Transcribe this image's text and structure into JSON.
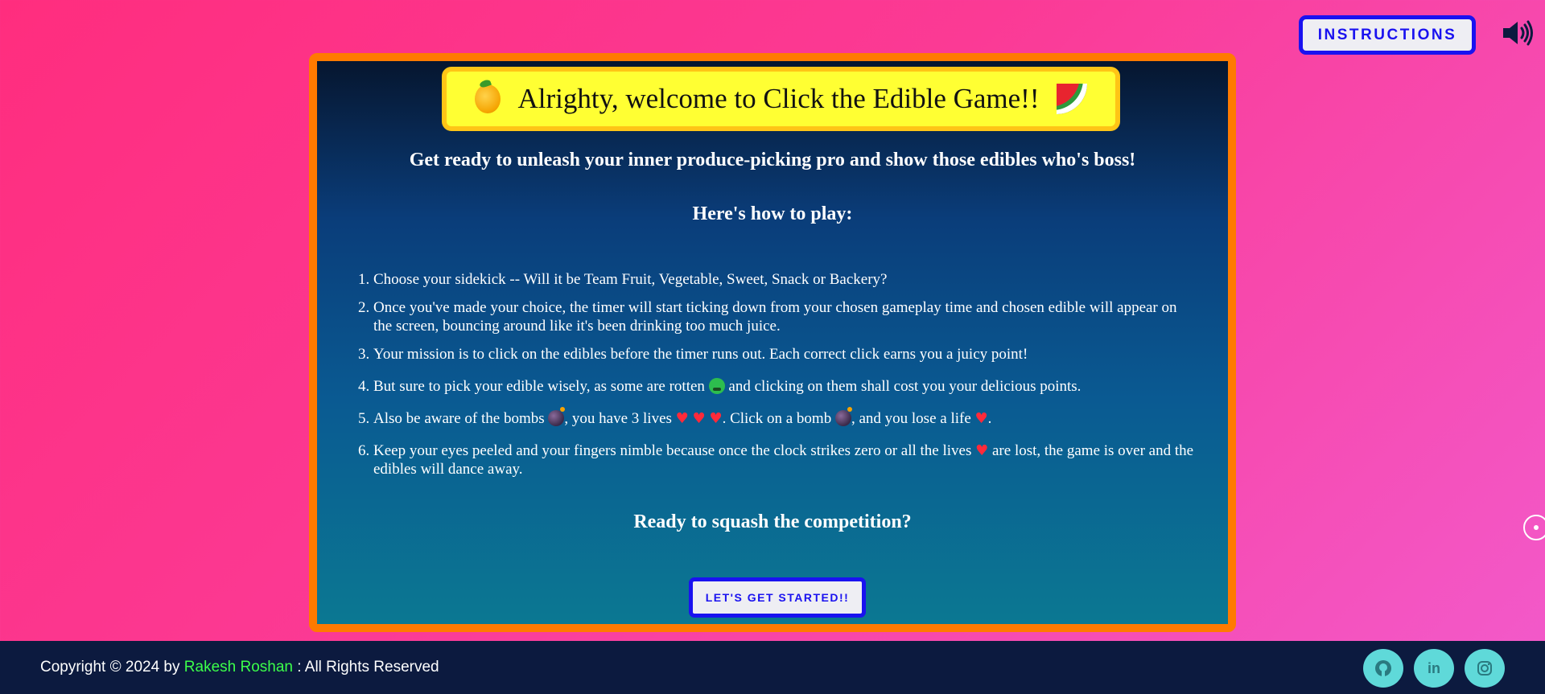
{
  "header": {
    "instructions_label": "INSTRUCTIONS",
    "sound_icon": "speaker-icon",
    "theme_icon": "moon-icon"
  },
  "card": {
    "title": "Alrighty, welcome to Click the Edible Game!!",
    "subtitle": "Get ready to unleash your inner produce-picking pro and show those edibles who's boss!",
    "howto": "Here's how to play:",
    "steps": [
      {
        "text": "Choose your sidekick -- Will it be Team Fruit, Vegetable, Sweet, Snack or Backery?"
      },
      {
        "text": "Once you've made your choice, the timer will start ticking down from your chosen gameplay time and chosen edible will appear on the screen, bouncing around like it's been drinking too much juice."
      },
      {
        "text": "Your mission is to click on the edibles before the timer runs out. Each correct click earns you a juicy point!"
      },
      {
        "a": "But sure to pick your edible wisely, as some are rotten",
        "b": "and clicking on them shall cost you your delicious points."
      },
      {
        "a": "Also be aware of the bombs",
        "b": ", you have 3 lives",
        "c": ". Click on a bomb",
        "d": ", and you lose a life",
        "e": "."
      },
      {
        "a": "Keep your eyes peeled and your fingers nimble because once the clock strikes zero or all the lives",
        "b": "are lost, the game is over and the edibles will dance away."
      }
    ],
    "ready": "Ready to squash the competition?",
    "start_label": "LET'S GET STARTED!!"
  },
  "footer": {
    "copyright_prefix": "Copyright © 2024 by",
    "author": "Rakesh Roshan",
    "copyright_suffix": ": All Rights Reserved",
    "social": [
      "github-icon",
      "linkedin-icon",
      "instagram-icon"
    ]
  },
  "colors": {
    "accent": "#1a12f0",
    "card_border": "#ff7a00",
    "title_bg": "#ffff33",
    "footer_bg": "#0c1a3f",
    "author": "#3cff4a"
  }
}
